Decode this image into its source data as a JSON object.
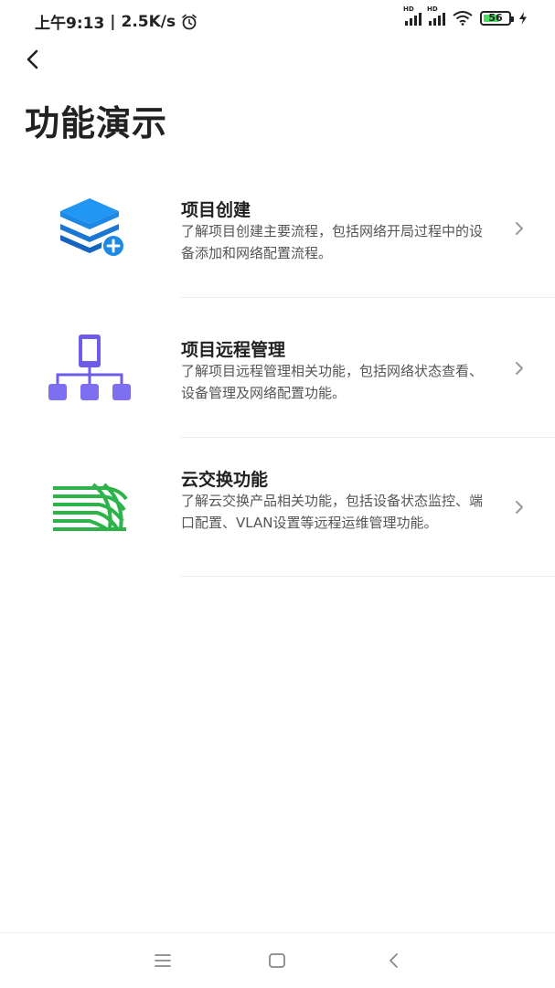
{
  "status_bar": {
    "time": "上午9:13",
    "network_speed": "2.5K/s",
    "separator": "|",
    "signal_label_1": "HD",
    "signal_label_2": "HD",
    "battery_level": "56"
  },
  "header": {
    "title": "功能演示"
  },
  "items": [
    {
      "title": "项目创建",
      "description": "了解项目创建主要流程，包括网络开局过程中的设备添加和网络配置流程。",
      "icon": "layers-add-icon",
      "icon_color": "#1e88e5"
    },
    {
      "title": "项目远程管理",
      "description": "了解项目远程管理相关功能，包括网络状态查看、设备管理及网络配置功能。",
      "icon": "remote-network-icon",
      "icon_color": "#6c5ce7"
    },
    {
      "title": "云交换功能",
      "description": "了解云交换产品相关功能，包括设备状态监控、端口配置、VLAN设置等远程运维管理功能。",
      "icon": "cloud-switch-icon",
      "icon_color": "#2db34a"
    }
  ],
  "nav_bar": {
    "items": [
      "menu",
      "home",
      "back"
    ]
  }
}
